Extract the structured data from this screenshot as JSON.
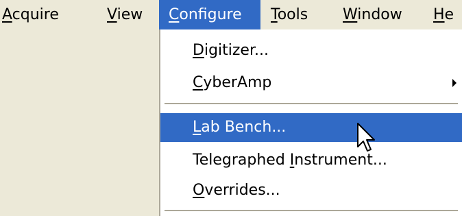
{
  "menubar": {
    "items": [
      {
        "label": "Acquire",
        "mnemonic": "A",
        "rest": "cquire"
      },
      {
        "label": "View",
        "mnemonic": "V",
        "rest": "iew"
      },
      {
        "label": "Configure",
        "mnemonic": "C",
        "rest": "onfigure"
      },
      {
        "label": "Tools",
        "mnemonic": "T",
        "rest": "ools"
      },
      {
        "label": "Window",
        "mnemonic": "W",
        "rest": "indow"
      },
      {
        "label": "He",
        "mnemonic": "H",
        "rest": "e"
      }
    ],
    "active_index": 2
  },
  "dropdown": {
    "items": [
      {
        "pre": "",
        "mnemonic": "D",
        "rest": "igitizer...",
        "has_submenu": false
      },
      {
        "pre": "",
        "mnemonic": "C",
        "rest": "yberAmp",
        "has_submenu": true
      },
      {
        "pre": "",
        "mnemonic": "L",
        "rest": "ab Bench...",
        "has_submenu": false,
        "highlighted": true
      },
      {
        "pre": "Telegraphed ",
        "mnemonic": "I",
        "rest": "nstrument...",
        "has_submenu": false
      },
      {
        "pre": "",
        "mnemonic": "O",
        "rest": "verrides...",
        "has_submenu": false
      }
    ]
  },
  "icons": {
    "cursor": "arrow-cursor-icon",
    "submenu": "submenu-arrow-icon"
  },
  "colors": {
    "menu_bg": "#ece9d8",
    "highlight": "#316ac5",
    "separator": "#aca899"
  }
}
